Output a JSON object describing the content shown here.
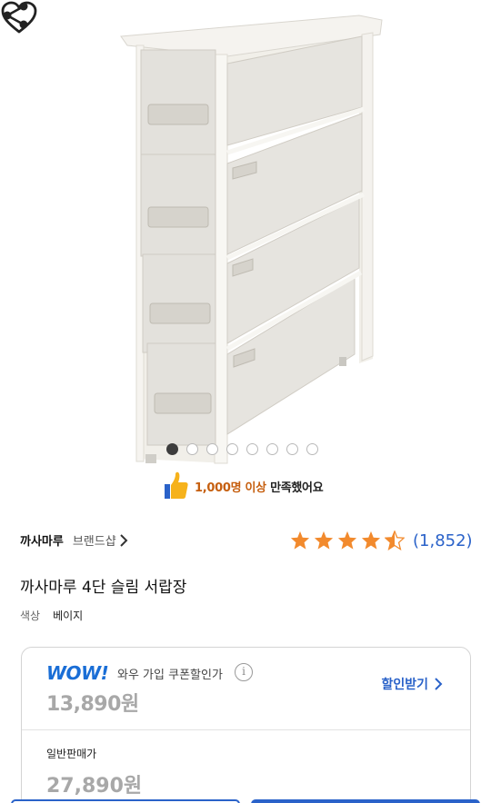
{
  "gallery": {
    "image_count": 8,
    "active_index": 0
  },
  "satisfaction": {
    "highlight": "1,000명 이상",
    "rest": "만족했어요"
  },
  "brand": {
    "name": "까사마루",
    "shop_label": "브랜드샵"
  },
  "rating": {
    "stars": 4.5,
    "review_count": "(1,852)",
    "star_color": "#f28a2d"
  },
  "product": {
    "title": "까사마루 4단 슬림 서랍장",
    "option_key": "색상",
    "option_value": "베이지"
  },
  "wow": {
    "logo": "WOW!",
    "description": "와우 가입 쿠폰할인가",
    "price": "13,890원",
    "coupon_button": "할인받기"
  },
  "normal": {
    "label": "일반판매가",
    "price": "27,890원"
  },
  "colors": {
    "accent": "#2a62c9",
    "wow_blue": "#1a6ed6",
    "muted_price": "#a8a8a8"
  },
  "icons": {
    "wishlist": "heart-icon",
    "share": "share-icon",
    "thumb": "thumbs-up-icon",
    "info": "info-icon",
    "chevron": "chevron-right-icon"
  }
}
